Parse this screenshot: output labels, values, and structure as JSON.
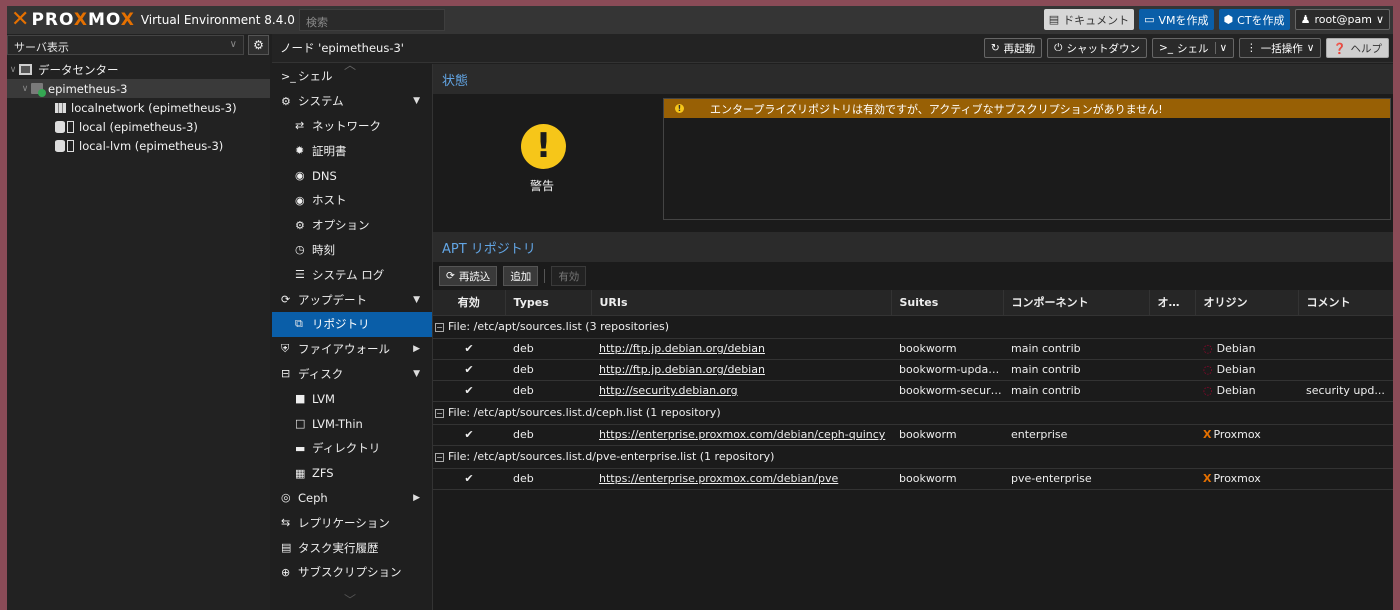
{
  "topbar": {
    "brand_x": "✕",
    "brand_pre": "PRO",
    "brand_x2": "X",
    "brand_mo": "MO",
    "brand_x3": "X",
    "version": "Virtual Environment 8.4.0",
    "search_placeholder": "検索",
    "doc_label": "ドキュメント",
    "create_vm_label": "VMを作成",
    "create_ct_label": "CTを作成",
    "user_label": "root@pam"
  },
  "sidebar": {
    "view_label": "サーバ表示",
    "tree": {
      "datacenter": "データセンター",
      "node": "epimetheus-3",
      "items": [
        "localnetwork (epimetheus-3)",
        "local (epimetheus-3)",
        "local-lvm (epimetheus-3)"
      ]
    }
  },
  "nodebar": {
    "title": "ノード 'epimetheus-3'",
    "reboot": "再起動",
    "shutdown": "シャットダウン",
    "shell": "シェル",
    "bulk": "一括操作",
    "help": "ヘルプ"
  },
  "menu": [
    {
      "label": "シェル",
      "icon": ">_",
      "sub": false
    },
    {
      "label": "システム",
      "icon": "⚙",
      "sub": false,
      "arrow": "▼"
    },
    {
      "label": "ネットワーク",
      "icon": "⇄",
      "sub": true
    },
    {
      "label": "証明書",
      "icon": "✹",
      "sub": true
    },
    {
      "label": "DNS",
      "icon": "◉",
      "sub": true
    },
    {
      "label": "ホスト",
      "icon": "◉",
      "sub": true
    },
    {
      "label": "オプション",
      "icon": "⚙",
      "sub": true
    },
    {
      "label": "時刻",
      "icon": "◷",
      "sub": true
    },
    {
      "label": "システム ログ",
      "icon": "☰",
      "sub": true
    },
    {
      "label": "アップデート",
      "icon": "⟳",
      "sub": false,
      "arrow": "▼"
    },
    {
      "label": "リポジトリ",
      "icon": "⧉",
      "sub": true,
      "active": true
    },
    {
      "label": "ファイアウォール",
      "icon": "⛨",
      "sub": false,
      "arrow": "▶"
    },
    {
      "label": "ディスク",
      "icon": "⊟",
      "sub": false,
      "arrow": "▼"
    },
    {
      "label": "LVM",
      "icon": "■",
      "sub": true
    },
    {
      "label": "LVM-Thin",
      "icon": "□",
      "sub": true
    },
    {
      "label": "ディレクトリ",
      "icon": "▬",
      "sub": true
    },
    {
      "label": "ZFS",
      "icon": "▦",
      "sub": true
    },
    {
      "label": "Ceph",
      "icon": "◎",
      "sub": false,
      "arrow": "▶"
    },
    {
      "label": "レプリケーション",
      "icon": "⇆",
      "sub": false
    },
    {
      "label": "タスク実行履歴",
      "icon": "▤",
      "sub": false
    },
    {
      "label": "サブスクリプション",
      "icon": "⊕",
      "sub": false
    }
  ],
  "status": {
    "header": "状態",
    "icon_text": "!",
    "warning_label": "警告",
    "message": "エンタープライズリポジトリは有効ですが、アクティブなサブスクリプションがありません!"
  },
  "apt": {
    "header": "APT リポジトリ",
    "reload": "再読込",
    "add": "追加",
    "enable": "有効",
    "columns": [
      "有効",
      "Types",
      "URIs",
      "Suites",
      "コンポーネント",
      "オ…",
      "オリジン",
      "コメント"
    ],
    "groups": [
      {
        "title": "File: /etc/apt/sources.list (3 repositories)",
        "rows": [
          {
            "enabled": "✔",
            "type": "deb",
            "uri": "http://ftp.jp.debian.org/debian",
            "suite": "bookworm",
            "component": "main contrib",
            "opt": "",
            "origin": "Debian",
            "origin_kind": "debian",
            "comment": ""
          },
          {
            "enabled": "✔",
            "type": "deb",
            "uri": "http://ftp.jp.debian.org/debian",
            "suite": "bookworm-updat...",
            "component": "main contrib",
            "opt": "",
            "origin": "Debian",
            "origin_kind": "debian",
            "comment": ""
          },
          {
            "enabled": "✔",
            "type": "deb",
            "uri": "http://security.debian.org",
            "suite": "bookworm-security",
            "component": "main contrib",
            "opt": "",
            "origin": "Debian",
            "origin_kind": "debian",
            "comment": "security upd..."
          }
        ]
      },
      {
        "title": "File: /etc/apt/sources.list.d/ceph.list (1 repository)",
        "rows": [
          {
            "enabled": "✔",
            "type": "deb",
            "uri": "https://enterprise.proxmox.com/debian/ceph-quincy",
            "suite": "bookworm",
            "component": "enterprise",
            "opt": "",
            "origin": "Proxmox",
            "origin_kind": "proxmox",
            "comment": ""
          }
        ]
      },
      {
        "title": "File: /etc/apt/sources.list.d/pve-enterprise.list (1 repository)",
        "rows": [
          {
            "enabled": "✔",
            "type": "deb",
            "uri": "https://enterprise.proxmox.com/debian/pve",
            "suite": "bookworm",
            "component": "pve-enterprise",
            "opt": "",
            "origin": "Proxmox",
            "origin_kind": "proxmox",
            "comment": ""
          }
        ]
      }
    ]
  },
  "colors": {
    "accent": "#0a5ea8",
    "warning": "#f6c619",
    "warning_bar": "#986005",
    "proxmox_orange": "#e57000",
    "debian_red": "#a80030"
  }
}
